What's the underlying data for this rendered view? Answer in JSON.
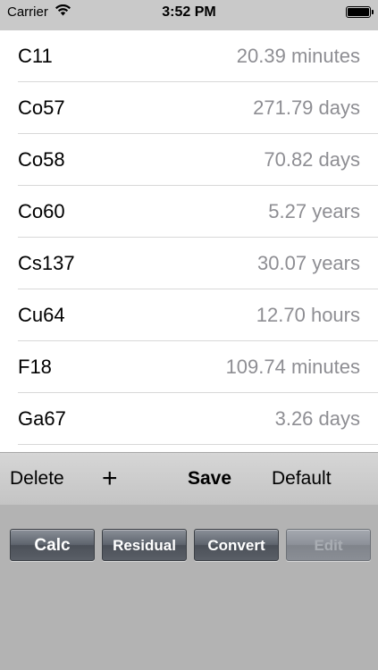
{
  "status_bar": {
    "carrier": "Carrier",
    "time": "3:52 PM",
    "wifi_icon": "wifi-icon",
    "battery_icon": "battery-icon"
  },
  "isotopes": [
    {
      "name": "C11",
      "half_life": "20.39 minutes"
    },
    {
      "name": "Co57",
      "half_life": "271.79 days"
    },
    {
      "name": "Co58",
      "half_life": "70.82 days"
    },
    {
      "name": "Co60",
      "half_life": "5.27 years"
    },
    {
      "name": "Cs137",
      "half_life": "30.07 years"
    },
    {
      "name": "Cu64",
      "half_life": "12.70 hours"
    },
    {
      "name": "F18",
      "half_life": "109.74 minutes"
    },
    {
      "name": "Ga67",
      "half_life": "3.26 days"
    }
  ],
  "toolbar": {
    "delete_label": "Delete",
    "add_label": "+",
    "save_label": "Save",
    "default_label": "Default"
  },
  "buttons": {
    "calc_label": "Calc",
    "residual_label": "Residual",
    "convert_label": "Convert",
    "edit_label": "Edit"
  },
  "colors": {
    "value_text": "#8e8e93",
    "panel_background": "#b3b3b3",
    "button_dark": "#5d636c"
  }
}
